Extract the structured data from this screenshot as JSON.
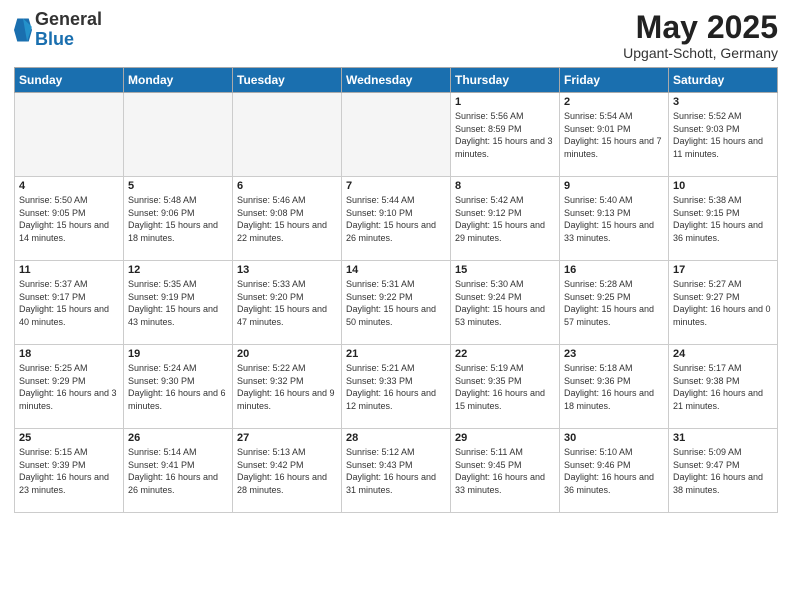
{
  "header": {
    "logo_general": "General",
    "logo_blue": "Blue",
    "month_title": "May 2025",
    "location": "Upgant-Schott, Germany"
  },
  "weekdays": [
    "Sunday",
    "Monday",
    "Tuesday",
    "Wednesday",
    "Thursday",
    "Friday",
    "Saturday"
  ],
  "weeks": [
    [
      {
        "day": "",
        "empty": true
      },
      {
        "day": "",
        "empty": true
      },
      {
        "day": "",
        "empty": true
      },
      {
        "day": "",
        "empty": true
      },
      {
        "day": "1",
        "sunrise": "5:56 AM",
        "sunset": "8:59 PM",
        "daylight": "15 hours and 3 minutes."
      },
      {
        "day": "2",
        "sunrise": "5:54 AM",
        "sunset": "9:01 PM",
        "daylight": "15 hours and 7 minutes."
      },
      {
        "day": "3",
        "sunrise": "5:52 AM",
        "sunset": "9:03 PM",
        "daylight": "15 hours and 11 minutes."
      }
    ],
    [
      {
        "day": "4",
        "sunrise": "5:50 AM",
        "sunset": "9:05 PM",
        "daylight": "15 hours and 14 minutes."
      },
      {
        "day": "5",
        "sunrise": "5:48 AM",
        "sunset": "9:06 PM",
        "daylight": "15 hours and 18 minutes."
      },
      {
        "day": "6",
        "sunrise": "5:46 AM",
        "sunset": "9:08 PM",
        "daylight": "15 hours and 22 minutes."
      },
      {
        "day": "7",
        "sunrise": "5:44 AM",
        "sunset": "9:10 PM",
        "daylight": "15 hours and 26 minutes."
      },
      {
        "day": "8",
        "sunrise": "5:42 AM",
        "sunset": "9:12 PM",
        "daylight": "15 hours and 29 minutes."
      },
      {
        "day": "9",
        "sunrise": "5:40 AM",
        "sunset": "9:13 PM",
        "daylight": "15 hours and 33 minutes."
      },
      {
        "day": "10",
        "sunrise": "5:38 AM",
        "sunset": "9:15 PM",
        "daylight": "15 hours and 36 minutes."
      }
    ],
    [
      {
        "day": "11",
        "sunrise": "5:37 AM",
        "sunset": "9:17 PM",
        "daylight": "15 hours and 40 minutes."
      },
      {
        "day": "12",
        "sunrise": "5:35 AM",
        "sunset": "9:19 PM",
        "daylight": "15 hours and 43 minutes."
      },
      {
        "day": "13",
        "sunrise": "5:33 AM",
        "sunset": "9:20 PM",
        "daylight": "15 hours and 47 minutes."
      },
      {
        "day": "14",
        "sunrise": "5:31 AM",
        "sunset": "9:22 PM",
        "daylight": "15 hours and 50 minutes."
      },
      {
        "day": "15",
        "sunrise": "5:30 AM",
        "sunset": "9:24 PM",
        "daylight": "15 hours and 53 minutes."
      },
      {
        "day": "16",
        "sunrise": "5:28 AM",
        "sunset": "9:25 PM",
        "daylight": "15 hours and 57 minutes."
      },
      {
        "day": "17",
        "sunrise": "5:27 AM",
        "sunset": "9:27 PM",
        "daylight": "16 hours and 0 minutes."
      }
    ],
    [
      {
        "day": "18",
        "sunrise": "5:25 AM",
        "sunset": "9:29 PM",
        "daylight": "16 hours and 3 minutes."
      },
      {
        "day": "19",
        "sunrise": "5:24 AM",
        "sunset": "9:30 PM",
        "daylight": "16 hours and 6 minutes."
      },
      {
        "day": "20",
        "sunrise": "5:22 AM",
        "sunset": "9:32 PM",
        "daylight": "16 hours and 9 minutes."
      },
      {
        "day": "21",
        "sunrise": "5:21 AM",
        "sunset": "9:33 PM",
        "daylight": "16 hours and 12 minutes."
      },
      {
        "day": "22",
        "sunrise": "5:19 AM",
        "sunset": "9:35 PM",
        "daylight": "16 hours and 15 minutes."
      },
      {
        "day": "23",
        "sunrise": "5:18 AM",
        "sunset": "9:36 PM",
        "daylight": "16 hours and 18 minutes."
      },
      {
        "day": "24",
        "sunrise": "5:17 AM",
        "sunset": "9:38 PM",
        "daylight": "16 hours and 21 minutes."
      }
    ],
    [
      {
        "day": "25",
        "sunrise": "5:15 AM",
        "sunset": "9:39 PM",
        "daylight": "16 hours and 23 minutes."
      },
      {
        "day": "26",
        "sunrise": "5:14 AM",
        "sunset": "9:41 PM",
        "daylight": "16 hours and 26 minutes."
      },
      {
        "day": "27",
        "sunrise": "5:13 AM",
        "sunset": "9:42 PM",
        "daylight": "16 hours and 28 minutes."
      },
      {
        "day": "28",
        "sunrise": "5:12 AM",
        "sunset": "9:43 PM",
        "daylight": "16 hours and 31 minutes."
      },
      {
        "day": "29",
        "sunrise": "5:11 AM",
        "sunset": "9:45 PM",
        "daylight": "16 hours and 33 minutes."
      },
      {
        "day": "30",
        "sunrise": "5:10 AM",
        "sunset": "9:46 PM",
        "daylight": "16 hours and 36 minutes."
      },
      {
        "day": "31",
        "sunrise": "5:09 AM",
        "sunset": "9:47 PM",
        "daylight": "16 hours and 38 minutes."
      }
    ]
  ],
  "labels": {
    "sunrise": "Sunrise:",
    "sunset": "Sunset:",
    "daylight": "Daylight hours"
  }
}
